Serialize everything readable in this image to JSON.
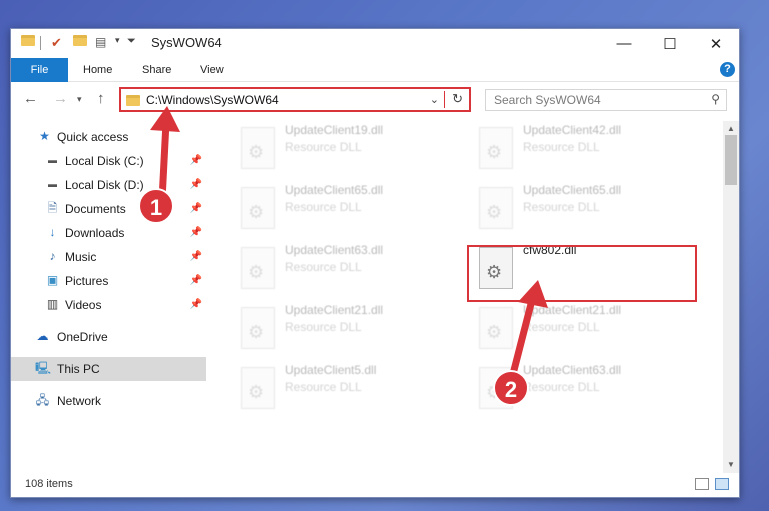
{
  "window": {
    "title": "SysWOW64",
    "controls": {
      "minimize": "—",
      "maximize": "☐",
      "close": "✕"
    }
  },
  "ribbon": {
    "tabs": [
      "File",
      "Home",
      "Share",
      "View"
    ],
    "help": "?"
  },
  "address": {
    "path": "C:\\Windows\\SysWOW64",
    "search_placeholder": "Search SysWOW64"
  },
  "sidebar": {
    "items": [
      {
        "label": "Quick access",
        "icon": "star-icon",
        "pinned": false
      },
      {
        "label": "Local Disk (C:)",
        "icon": "drive-icon",
        "pinned": true
      },
      {
        "label": "Local Disk (D:)",
        "icon": "drive-icon",
        "pinned": true
      },
      {
        "label": "Documents",
        "icon": "documents-icon",
        "pinned": true
      },
      {
        "label": "Downloads",
        "icon": "download-icon",
        "pinned": true
      },
      {
        "label": "Music",
        "icon": "music-icon",
        "pinned": true
      },
      {
        "label": "Pictures",
        "icon": "pictures-icon",
        "pinned": true
      },
      {
        "label": "Videos",
        "icon": "videos-icon",
        "pinned": true
      },
      {
        "label": "OneDrive",
        "icon": "cloud-icon",
        "pinned": false
      },
      {
        "label": "This PC",
        "icon": "computer-icon",
        "pinned": false,
        "selected": true
      },
      {
        "label": "Network",
        "icon": "network-icon",
        "pinned": false
      }
    ]
  },
  "files": [
    {
      "name": "UpdateClient19.dll",
      "type": "Resource DLL",
      "faded": true
    },
    {
      "name": "UpdateClient42.dll",
      "type": "Resource DLL",
      "faded": true
    },
    {
      "name": "UpdateClient65.dll",
      "type": "Resource DLL",
      "faded": true
    },
    {
      "name": "UpdateClient65.dll",
      "type": "Resource DLL",
      "faded": true
    },
    {
      "name": "UpdateClient63.dll",
      "type": "Resource DLL",
      "faded": true
    },
    {
      "name": "cfw802.dll",
      "type": "",
      "faded": false
    },
    {
      "name": "UpdateClient21.dll",
      "type": "Resource DLL",
      "faded": true
    },
    {
      "name": "UpdateClient21.dll",
      "type": "Resource DLL",
      "faded": true
    },
    {
      "name": "UpdateClient5.dll",
      "type": "Resource DLL",
      "faded": true
    },
    {
      "name": "UpdateClient63.dll",
      "type": "Resource DLL",
      "faded": true
    }
  ],
  "status": {
    "item_count": "108 items"
  },
  "callouts": [
    "1",
    "2"
  ],
  "colors": {
    "accent": "#1979ca",
    "highlight": "#d9343a"
  }
}
